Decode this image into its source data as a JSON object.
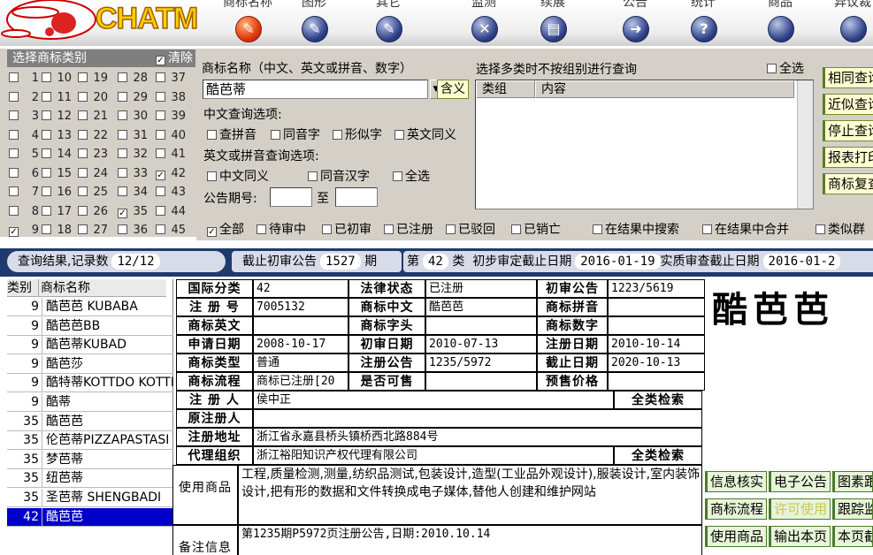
{
  "app": {
    "logo_text": "CHATM"
  },
  "nav": [
    {
      "label": "商标名称",
      "icon": "pencil-icon",
      "glyph": "✎",
      "active": true
    },
    {
      "label": "图形",
      "icon": "pencil-icon",
      "glyph": "✎"
    },
    {
      "label": "其它",
      "icon": "pencil-icon",
      "glyph": "✎"
    },
    {
      "label": "监测",
      "icon": "tools-icon",
      "glyph": "✕"
    },
    {
      "label": "续展",
      "icon": "bars-icon",
      "glyph": "▤"
    },
    {
      "label": "公告",
      "icon": "arrow-right-icon",
      "glyph": "➜"
    },
    {
      "label": "统计",
      "icon": "help-icon",
      "glyph": "?"
    },
    {
      "label": "商品",
      "icon": "circle-icon",
      "glyph": ""
    },
    {
      "label": "异议裁",
      "icon": "circle-icon",
      "glyph": ""
    }
  ],
  "category": {
    "title": "选择商标类别",
    "clear_label": "清除",
    "clear_checked": true,
    "items": [
      {
        "n": "1",
        "c": false
      },
      {
        "n": "10",
        "c": false
      },
      {
        "n": "19",
        "c": false
      },
      {
        "n": "28",
        "c": false
      },
      {
        "n": "37",
        "c": false
      },
      {
        "n": "2",
        "c": false
      },
      {
        "n": "11",
        "c": false
      },
      {
        "n": "20",
        "c": false
      },
      {
        "n": "29",
        "c": false
      },
      {
        "n": "38",
        "c": false
      },
      {
        "n": "3",
        "c": false
      },
      {
        "n": "12",
        "c": false
      },
      {
        "n": "21",
        "c": false
      },
      {
        "n": "30",
        "c": false
      },
      {
        "n": "39",
        "c": false
      },
      {
        "n": "4",
        "c": false
      },
      {
        "n": "13",
        "c": false
      },
      {
        "n": "22",
        "c": false
      },
      {
        "n": "31",
        "c": false
      },
      {
        "n": "40",
        "c": false
      },
      {
        "n": "5",
        "c": false
      },
      {
        "n": "14",
        "c": false
      },
      {
        "n": "23",
        "c": false
      },
      {
        "n": "32",
        "c": false
      },
      {
        "n": "41",
        "c": false
      },
      {
        "n": "6",
        "c": false
      },
      {
        "n": "15",
        "c": false
      },
      {
        "n": "24",
        "c": false
      },
      {
        "n": "33",
        "c": false
      },
      {
        "n": "42",
        "c": true
      },
      {
        "n": "7",
        "c": false
      },
      {
        "n": "16",
        "c": false
      },
      {
        "n": "25",
        "c": false
      },
      {
        "n": "34",
        "c": false
      },
      {
        "n": "43",
        "c": false
      },
      {
        "n": "8",
        "c": false
      },
      {
        "n": "17",
        "c": false
      },
      {
        "n": "26",
        "c": false
      },
      {
        "n": "35",
        "c": true
      },
      {
        "n": "44",
        "c": false
      },
      {
        "n": "9",
        "c": true
      },
      {
        "n": "18",
        "c": false
      },
      {
        "n": "27",
        "c": false
      },
      {
        "n": "36",
        "c": false
      },
      {
        "n": "45",
        "c": false
      }
    ]
  },
  "query": {
    "name_label": "商标名称（中文、英文或拼音、数字）",
    "name_value": "酷芭蒂",
    "contain_btn": "含义",
    "cn_options_label": "中文查询选项:",
    "cn_options": [
      {
        "label": "查拼音"
      },
      {
        "label": "同音字"
      },
      {
        "label": "形似字"
      },
      {
        "label": "英文同义"
      }
    ],
    "en_options_label": "英文或拼音查询选项:",
    "en_options": [
      {
        "label": "中文同义"
      },
      {
        "label": "同音汉字"
      },
      {
        "label": "全选"
      }
    ],
    "period_label": "公告期号:",
    "period_to": "至",
    "multi_label": "选择多类时不按组别进行查询",
    "select_all": "全选",
    "grid_headers": [
      "类组",
      "内容"
    ],
    "side_buttons": [
      "相同查询",
      "近似查询",
      "停止查询",
      "报表打印",
      "商标复查"
    ],
    "status_filters": [
      {
        "label": "全部",
        "c": true
      },
      {
        "label": "待审中",
        "c": false
      },
      {
        "label": "已初审",
        "c": false
      },
      {
        "label": "已注册",
        "c": false
      },
      {
        "label": "已驳回",
        "c": false
      },
      {
        "label": "已销亡",
        "c": false
      }
    ],
    "result_opts": [
      "在结果中搜索",
      "在结果中合并",
      "类似群"
    ]
  },
  "status": {
    "result_label": "查询结果,记录数",
    "result_count": "12/12",
    "cutoff_label": "截止初审公告",
    "cutoff_num": "1527",
    "cutoff_unit": "期",
    "class_prefix": "第",
    "class_num": "42",
    "class_suffix": "类",
    "prelim_label": "初步审定截止日期",
    "prelim_date": "2016-01-19",
    "exam_label": "实质审查截止日期",
    "exam_date": "2016-01-2"
  },
  "results": {
    "headers": [
      "类别",
      "商标名称"
    ],
    "rows": [
      {
        "cls": "9",
        "name": "酷芭芭 KUBABA"
      },
      {
        "cls": "9",
        "name": "酷芭芭BB"
      },
      {
        "cls": "9",
        "name": "酷芭蒂KUBAD"
      },
      {
        "cls": "9",
        "name": "酷芭莎"
      },
      {
        "cls": "9",
        "name": "酷特蒂KOTTDO KOTTI"
      },
      {
        "cls": "9",
        "name": "酷蒂"
      },
      {
        "cls": "35",
        "name": "酷芭芭"
      },
      {
        "cls": "35",
        "name": "伦芭蒂PIZZAPASTASI"
      },
      {
        "cls": "35",
        "name": "梦芭蒂"
      },
      {
        "cls": "35",
        "name": "纽芭蒂"
      },
      {
        "cls": "35",
        "name": "圣芭蒂 SHENGBADI"
      },
      {
        "cls": "42",
        "name": "酷芭芭",
        "selected": true
      }
    ]
  },
  "detail": {
    "intl_class_l": "国际分类",
    "intl_class": "42",
    "legal_l": "法律状态",
    "legal": "已注册",
    "first_l": "初审公告",
    "first": "1223/5619",
    "regno_l": "注 册 号",
    "regno": "7005132",
    "cn_l": "商标中文",
    "cn": "酷芭芭",
    "py_l": "商标拼音",
    "py": "",
    "en_l": "商标英文",
    "en": "",
    "head_l": "商标字头",
    "head": "",
    "num_l": "商标数字",
    "num": "",
    "appdate_l": "申请日期",
    "appdate": "2008-10-17",
    "firstdate_l": "初审日期",
    "firstdate": "2010-07-13",
    "regdate_l": "注册日期",
    "regdate": "2010-10-14",
    "type_l": "商标类型",
    "type": "普通",
    "regpub_l": "注册公告",
    "regpub": "1235/5972",
    "expire_l": "截止日期",
    "expire": "2020-10-13",
    "flow_l": "商标流程",
    "flow": "商标已注册[20",
    "sale_l": "是否可售",
    "sale": "",
    "price_l": "预售价格",
    "price": "",
    "owner_l": "注 册 人",
    "owner": "侯中正",
    "owner_search": "全类检索",
    "orig_l": "原注册人",
    "orig": "",
    "addr_l": "注册地址",
    "addr": "浙江省永嘉县桥头镇桥西北路884号",
    "agent_l": "代理组织",
    "agent": "浙江裕阳知识产权代理有限公司",
    "agent_search": "全类检索",
    "goods_l": "使用商品",
    "goods": "工程,质量检测,测量,纺织品测试,包装设计,造型(工业品外观设计),服装设计,室内装饰设计,把有形的数据和文件转换成电子媒体,替他人创建和维护网站",
    "note_l": "备注信息",
    "note": "第1235期P5972页注册公告,日期:2010.10.14"
  },
  "big_name": "酷芭芭",
  "right_buttons": [
    "信息核实",
    "电子公告",
    "图素跟",
    "商标流程",
    "许可使用",
    "跟踪监",
    "使用商品",
    "输出本页",
    "本页截"
  ]
}
